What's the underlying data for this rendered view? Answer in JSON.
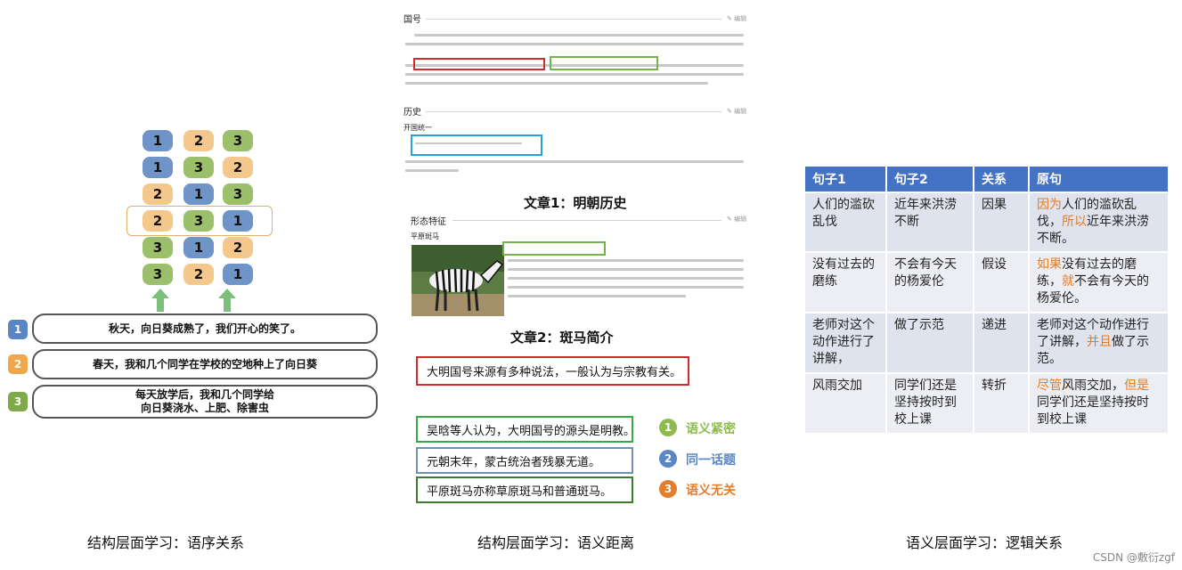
{
  "panel1": {
    "grid_rows": [
      [
        1,
        2,
        3
      ],
      [
        1,
        3,
        2
      ],
      [
        2,
        1,
        3
      ],
      [
        2,
        3,
        1
      ],
      [
        3,
        1,
        2
      ],
      [
        3,
        2,
        1
      ]
    ],
    "sentences": [
      {
        "num": "1",
        "text": "秋天，向日葵成熟了，我们开心的笑了。"
      },
      {
        "num": "2",
        "text": "春天，我和几个同学在学校的空地种上了向日葵"
      },
      {
        "num": "3",
        "text_line1": "每天放学后，我和几个同学给",
        "text_line2": "向日葵浇水、上肥、除害虫"
      }
    ],
    "caption": "结构层面学习：语序关系",
    "colors": {
      "1": "#6f94c8",
      "2": "#f4c78d",
      "3": "#9cbf6c"
    }
  },
  "panel2": {
    "doc1": {
      "section1": "国号",
      "section2": "历史",
      "subsection": "开国统一",
      "edit": "✎ 编辑"
    },
    "doc1_title": "文章1：明朝历史",
    "doc2": {
      "section": "形态特征",
      "subsection": "平原斑马",
      "edit": "✎ 编辑"
    },
    "doc2_title": "文章2：斑马简介",
    "query": "大明国号来源有多种说法，一般认为与宗教有关。",
    "candidates": [
      "吴晗等人认为，大明国号的源头是明教。",
      "元朝末年，蒙古统治者残暴无道。",
      "平原斑马亦称草原斑马和普通斑马。"
    ],
    "legend": [
      {
        "num": "1",
        "label": "语义紧密",
        "color": "#8dbb4f"
      },
      {
        "num": "2",
        "label": "同一话题",
        "color": "#5a86c5"
      },
      {
        "num": "3",
        "label": "语义无关",
        "color": "#e57d2a"
      }
    ],
    "caption": "结构层面学习：语义距离"
  },
  "panel3": {
    "headers": [
      "句子1",
      "句子2",
      "关系",
      "原句"
    ],
    "rows": [
      {
        "s1": "人们的滥砍乱伐",
        "s2": "近年来洪涝不断",
        "rel": "因果",
        "orig": [
          {
            "t": "因为",
            "h": true
          },
          {
            "t": "人们的滥砍乱伐，",
            "h": false
          },
          {
            "t": "所以",
            "h": true
          },
          {
            "t": "近年来洪涝不断。",
            "h": false
          }
        ]
      },
      {
        "s1": "没有过去的磨练",
        "s2": "不会有今天的杨爱伦",
        "rel": "假设",
        "orig": [
          {
            "t": "如果",
            "h": true
          },
          {
            "t": "没有过去的磨练，",
            "h": false
          },
          {
            "t": "就",
            "h": true
          },
          {
            "t": "不会有今天的杨爱伦。",
            "h": false
          }
        ]
      },
      {
        "s1": "老师对这个动作进行了讲解，",
        "s2": "做了示范",
        "rel": "递进",
        "orig": [
          {
            "t": "老师对这个动作进行了讲解，",
            "h": false
          },
          {
            "t": "并且",
            "h": true
          },
          {
            "t": "做了示范。",
            "h": false
          }
        ]
      },
      {
        "s1": "风雨交加",
        "s2": "同学们还是坚持按时到校上课",
        "rel": "转折",
        "orig": [
          {
            "t": "尽管",
            "h": true
          },
          {
            "t": "风雨交加，",
            "h": false
          },
          {
            "t": "但是",
            "h": true
          },
          {
            "t": "同学们还是坚持按时到校上课",
            "h": false
          }
        ]
      }
    ],
    "caption": "语义层面学习：逻辑关系"
  },
  "watermark": "CSDN @敷衍zgf"
}
